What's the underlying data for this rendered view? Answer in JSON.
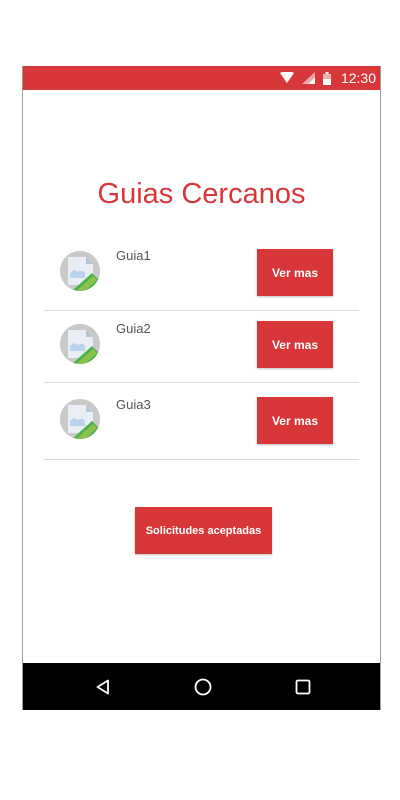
{
  "status_bar": {
    "time": "12:30",
    "icons": [
      "wifi-icon",
      "signal-icon",
      "battery-icon"
    ],
    "color": "#d8373a"
  },
  "title": "Guias Cercanos",
  "guides": [
    {
      "name": "Guia1",
      "button_label": "Ver mas",
      "avatar": "image-placeholder-icon"
    },
    {
      "name": "Guia2",
      "button_label": "Ver mas",
      "avatar": "image-placeholder-icon"
    },
    {
      "name": "Guia3",
      "button_label": "Ver mas",
      "avatar": "image-placeholder-icon"
    }
  ],
  "accepted_button_label": "Solicitudes aceptadas",
  "nav_bar": {
    "items": [
      "back-icon",
      "home-icon",
      "recents-icon"
    ]
  },
  "colors": {
    "accent": "#d8373a",
    "nav_background": "#000000",
    "divider": "#dddddd"
  }
}
